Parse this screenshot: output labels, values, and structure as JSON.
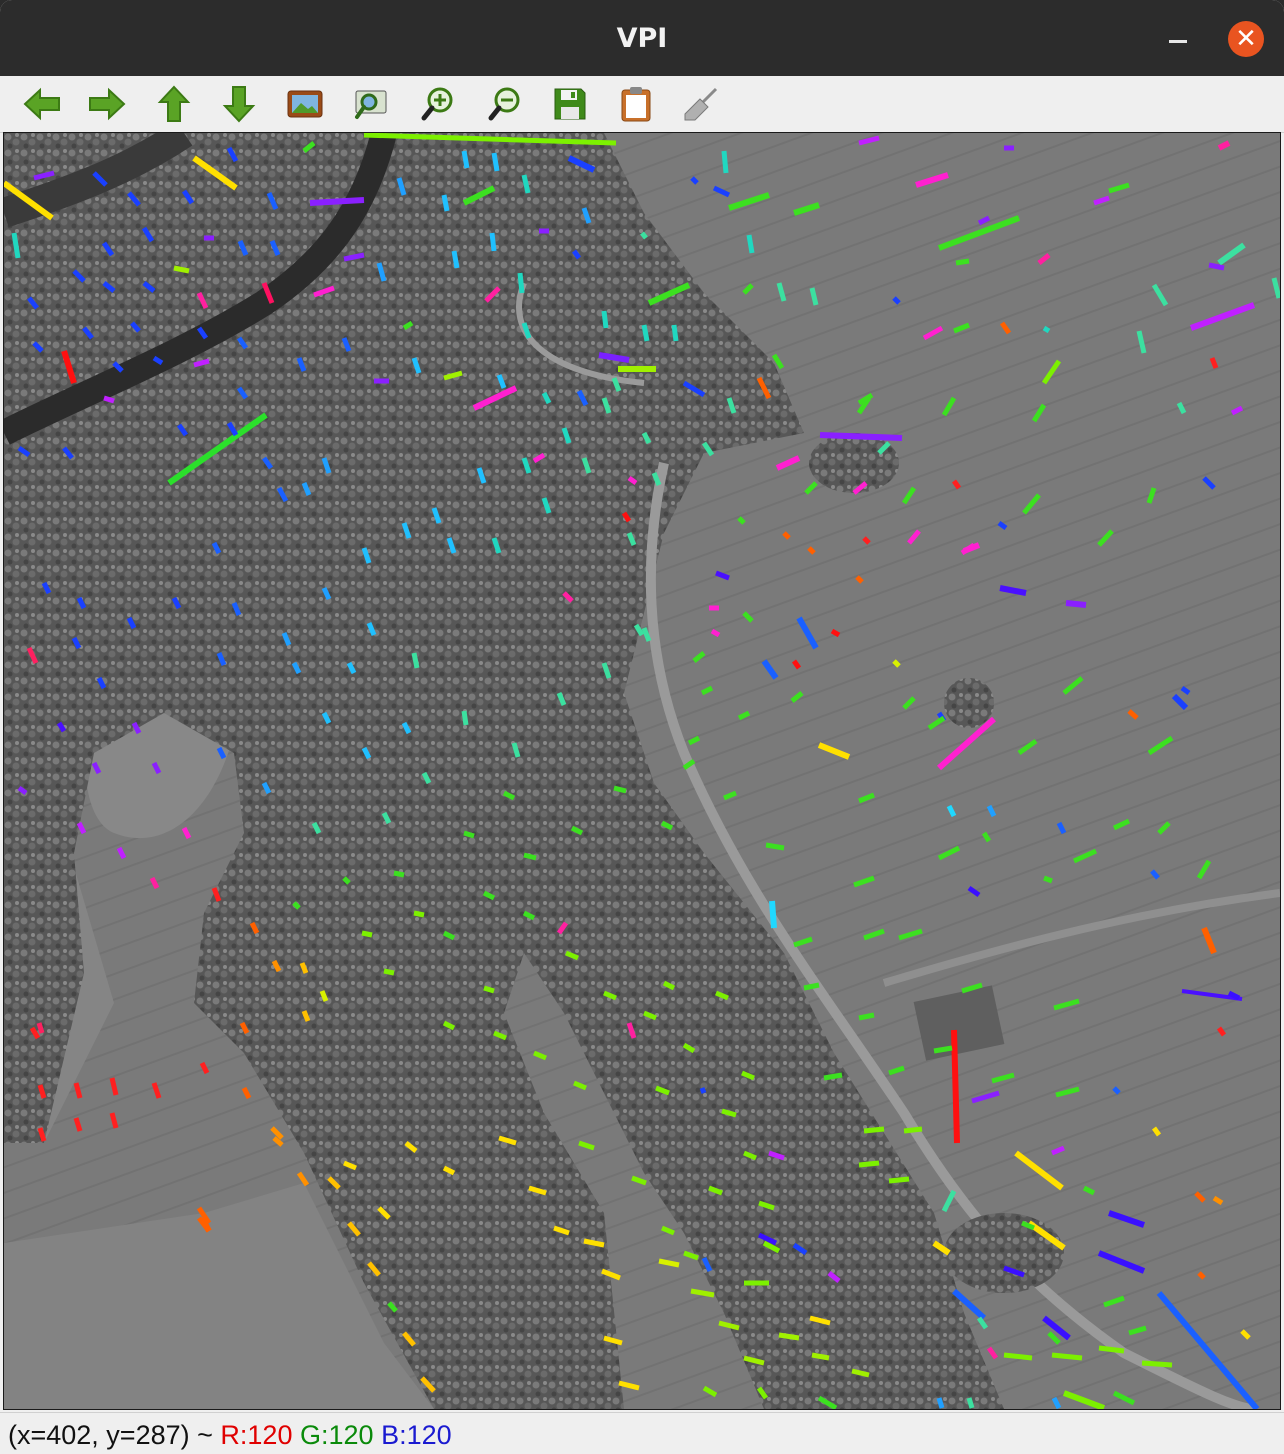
{
  "window": {
    "title": "VPI"
  },
  "toolbar": {
    "buttons": [
      {
        "name": "back-button",
        "icon": "arrow-left-icon"
      },
      {
        "name": "forward-button",
        "icon": "arrow-right-icon"
      },
      {
        "name": "up-button",
        "icon": "arrow-up-icon"
      },
      {
        "name": "down-button",
        "icon": "arrow-down-icon"
      },
      {
        "name": "image-button",
        "icon": "picture-icon"
      },
      {
        "name": "zoom-fit-button",
        "icon": "zoom-picture-icon"
      },
      {
        "name": "zoom-in-button",
        "icon": "zoom-in-icon"
      },
      {
        "name": "zoom-out-button",
        "icon": "zoom-out-icon"
      },
      {
        "name": "save-button",
        "icon": "floppy-disk-icon"
      },
      {
        "name": "clipboard-button",
        "icon": "clipboard-icon"
      },
      {
        "name": "clear-button",
        "icon": "broom-icon"
      }
    ]
  },
  "status": {
    "coords": "(x=402, y=287) ~",
    "r": "R:120",
    "g": "G:120",
    "b": "B:120"
  },
  "colors": {
    "titlebar": "#2c2c2c",
    "close": "#e95420",
    "toolbar_icon_green": "#4c9a1c"
  }
}
